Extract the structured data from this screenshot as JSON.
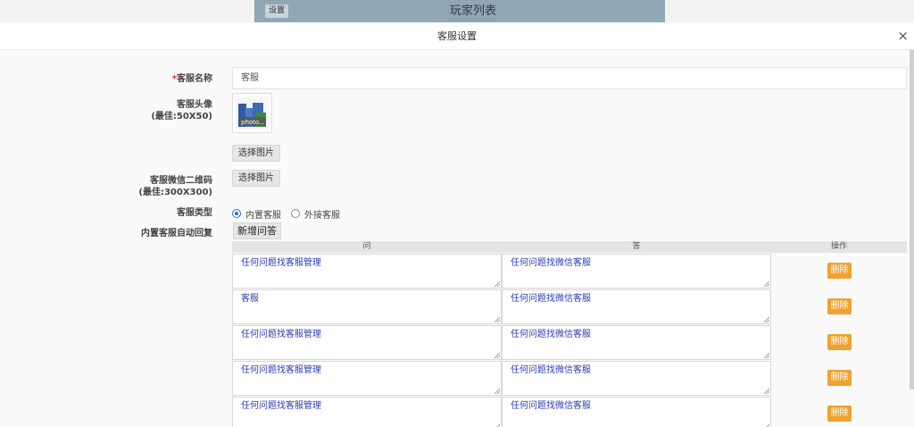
{
  "background": {
    "settings_label": "设置",
    "page_title": "玩家列表"
  },
  "modal": {
    "title": "客服设置",
    "close_glyph": "×"
  },
  "form": {
    "name_label_required": "*",
    "name_label": "客服名称",
    "name_value": "客服",
    "avatar_label_line1": "客服头像",
    "avatar_label_line2": "(最佳:50X50)",
    "avatar_caption": "photo...",
    "choose_image_label": "选择图片",
    "qrcode_label_line1": "客服微信二维码",
    "qrcode_label_line2": "(最佳:300X300)",
    "qrcode_choose_label": "选择图片",
    "type_label": "客服类型",
    "type_options": [
      "内置客服",
      "外接客服"
    ],
    "type_selected": "内置客服",
    "auto_reply_label": "内置客服自动回复",
    "add_qa_label": "新增问答"
  },
  "qa_table": {
    "headers": [
      "问",
      "答",
      "操作"
    ],
    "delete_label": "删除",
    "rows": [
      {
        "question": "任何问题找客服管理",
        "answer": "任何问题找微信客服"
      },
      {
        "question": "客服",
        "answer": "任何问题找微信客服"
      },
      {
        "question": "任何问题找客服管理",
        "answer": "任何问题找微信客服"
      },
      {
        "question": "任何问题找客服管理",
        "answer": "任何问题找微信客服"
      },
      {
        "question": "任何问题找客服管理",
        "answer": "任何问题找微信客服"
      }
    ]
  },
  "colors": {
    "accent_delete": "#f0a22e",
    "radio_selected": "#1e6fd9",
    "textarea_text": "#2a3db0"
  }
}
